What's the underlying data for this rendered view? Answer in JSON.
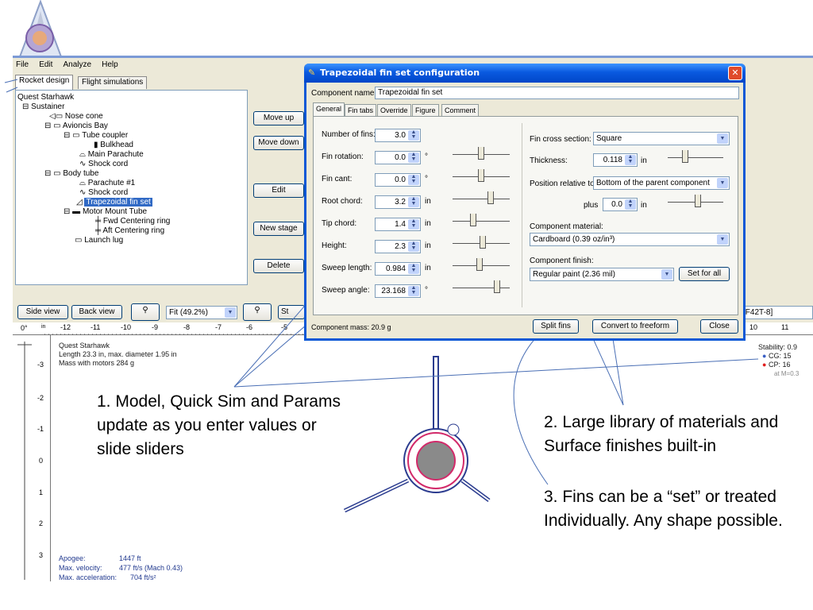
{
  "menu": [
    "File",
    "Edit",
    "Analyze",
    "Help"
  ],
  "tabs": [
    "Rocket design",
    "Flight simulations"
  ],
  "tree": {
    "root": "Quest Starhawk",
    "items": [
      {
        "label": "Sustainer",
        "depth": 0
      },
      {
        "label": "Nose cone",
        "depth": 1
      },
      {
        "label": "Avioncis Bay",
        "depth": 1
      },
      {
        "label": "Tube coupler",
        "depth": 2
      },
      {
        "label": "Bulkhead",
        "depth": 3
      },
      {
        "label": "Main Parachute",
        "depth": 2
      },
      {
        "label": "Shock cord",
        "depth": 2
      },
      {
        "label": "Body tube",
        "depth": 1
      },
      {
        "label": "Parachute #1",
        "depth": 2
      },
      {
        "label": "Shock cord",
        "depth": 2
      },
      {
        "label": "Trapezoidal fin set",
        "depth": 2,
        "selected": true
      },
      {
        "label": "Motor Mount Tube",
        "depth": 2
      },
      {
        "label": "Fwd Centering ring",
        "depth": 3
      },
      {
        "label": "Aft Centering ring",
        "depth": 3
      },
      {
        "label": "Launch lug",
        "depth": 1
      }
    ]
  },
  "side_buttons": {
    "move_up": "Move up",
    "move_down": "Move down",
    "edit": "Edit",
    "new_stage": "New stage",
    "delete": "Delete"
  },
  "view_bar": {
    "side_view": "Side view",
    "back_view": "Back view",
    "zoom": "Fit (49.2%)",
    "stage_partial": "St",
    "motor_partial": "[F42T-8]"
  },
  "dialog": {
    "title": "Trapezoidal fin set configuration",
    "component_name_label": "Component name:",
    "component_name_value": "Trapezoidal fin set",
    "tabs": [
      "General",
      "Fin tabs",
      "Override",
      "Figure",
      "Comment"
    ],
    "fields": [
      {
        "label": "Number of fins:",
        "value": "3.0",
        "unit": ""
      },
      {
        "label": "Fin rotation:",
        "value": "0.0",
        "unit": "°"
      },
      {
        "label": "Fin cant:",
        "value": "0.0",
        "unit": "°"
      },
      {
        "label": "Root chord:",
        "value": "3.2",
        "unit": "in"
      },
      {
        "label": "Tip chord:",
        "value": "1.4",
        "unit": "in"
      },
      {
        "label": "Height:",
        "value": "2.3",
        "unit": "in"
      },
      {
        "label": "Sweep length:",
        "value": "0.984",
        "unit": "in"
      },
      {
        "label": "Sweep angle:",
        "value": "23.168",
        "unit": "°"
      }
    ],
    "cross_section_label": "Fin cross section:",
    "cross_section_value": "Square",
    "thickness_label": "Thickness:",
    "thickness_value": "0.118",
    "thickness_unit": "in",
    "position_label": "Position relative to:",
    "position_value": "Bottom of the parent component",
    "plus_label": "plus",
    "plus_value": "0.0",
    "plus_unit": "in",
    "material_label": "Component material:",
    "material_value": "Cardboard (0.39 oz/in³)",
    "finish_label": "Component finish:",
    "finish_value": "Regular paint (2.36 mil)",
    "set_for_all": "Set for all",
    "mass": "Component mass: 20.9 g",
    "split_fins": "Split fins",
    "convert": "Convert to freeform",
    "close": "Close"
  },
  "rocket_info": {
    "name": "Quest Starhawk",
    "length": "Length 23.3 in, max. diameter 1.95 in",
    "mass": "Mass with motors 284 g",
    "stability": "Stability: 0.9",
    "cg": "CG:  15",
    "cp": "CP:  16",
    "mach": "at M=0.3"
  },
  "sim": {
    "apogee_label": "Apogee:",
    "apogee": "1447 ft",
    "vel_label": "Max. velocity:",
    "vel": "477 ft/s  (Mach 0.43)",
    "acc_label": "Max. acceleration:",
    "acc": "704 ft/s²"
  },
  "ruler_top": [
    "-12",
    "-11",
    "-10",
    "-9",
    "-8",
    "-7",
    "-6",
    "-5",
    "10",
    "11"
  ],
  "ruler_left": [
    "-3",
    "-2",
    "-1",
    "0",
    "1",
    "2",
    "3"
  ],
  "ruler_corner": [
    "0°",
    "in"
  ],
  "callouts": {
    "c1_line1": "1. Model, Quick Sim and Params",
    "c1_line2": "update as you enter values or",
    "c1_line3": "slide sliders",
    "c2_line1": "2. Large library of materials and",
    "c2_line2": "Surface finishes built-in",
    "c3_line1": "3. Fins can be a “set” or treated",
    "c3_line2": "Individually.  Any shape possible."
  },
  "colors": {
    "title_bar": "#0a5ae0",
    "selection": "#316ac5",
    "window_bg": "#ece9d8",
    "callout_line": "#4a6fb5"
  },
  "icons": [
    "logo-icon",
    "search-icon",
    "close-icon",
    "chevron-down-icon",
    "spin-arrows-icon",
    "fin-set-icon"
  ]
}
